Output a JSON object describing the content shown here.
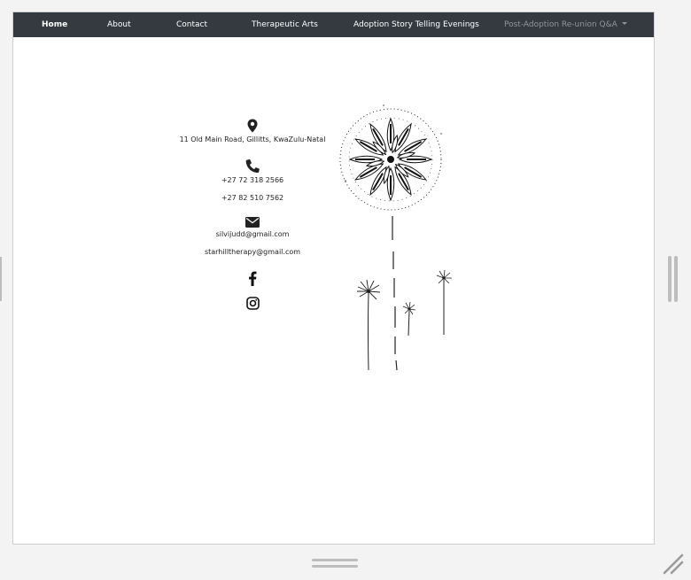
{
  "nav": {
    "items": [
      {
        "label": "Home"
      },
      {
        "label": "About"
      },
      {
        "label": "Contact"
      },
      {
        "label": "Therapeutic Arts"
      },
      {
        "label": "Adoption Story Telling Evenings"
      },
      {
        "label": "Post-Adoption Re-union Q&A"
      }
    ]
  },
  "contact": {
    "address": "11 Old Main Road, Gillitts, KwaZulu-Natal",
    "phones": [
      "+27 72 318 2566",
      "+27 82 510 7562"
    ],
    "emails": [
      "silvijudd@gmail.com",
      "starhilltherapy@gmail.com"
    ]
  },
  "icons": [
    "map-marker-icon",
    "phone-icon",
    "envelope-icon",
    "facebook-icon",
    "instagram-icon"
  ],
  "colors": {
    "navbar": "#343a40",
    "nav_text": "#ffffff",
    "nav_dropdown_text": "#8f959b",
    "page_bg": "#ffffff"
  }
}
